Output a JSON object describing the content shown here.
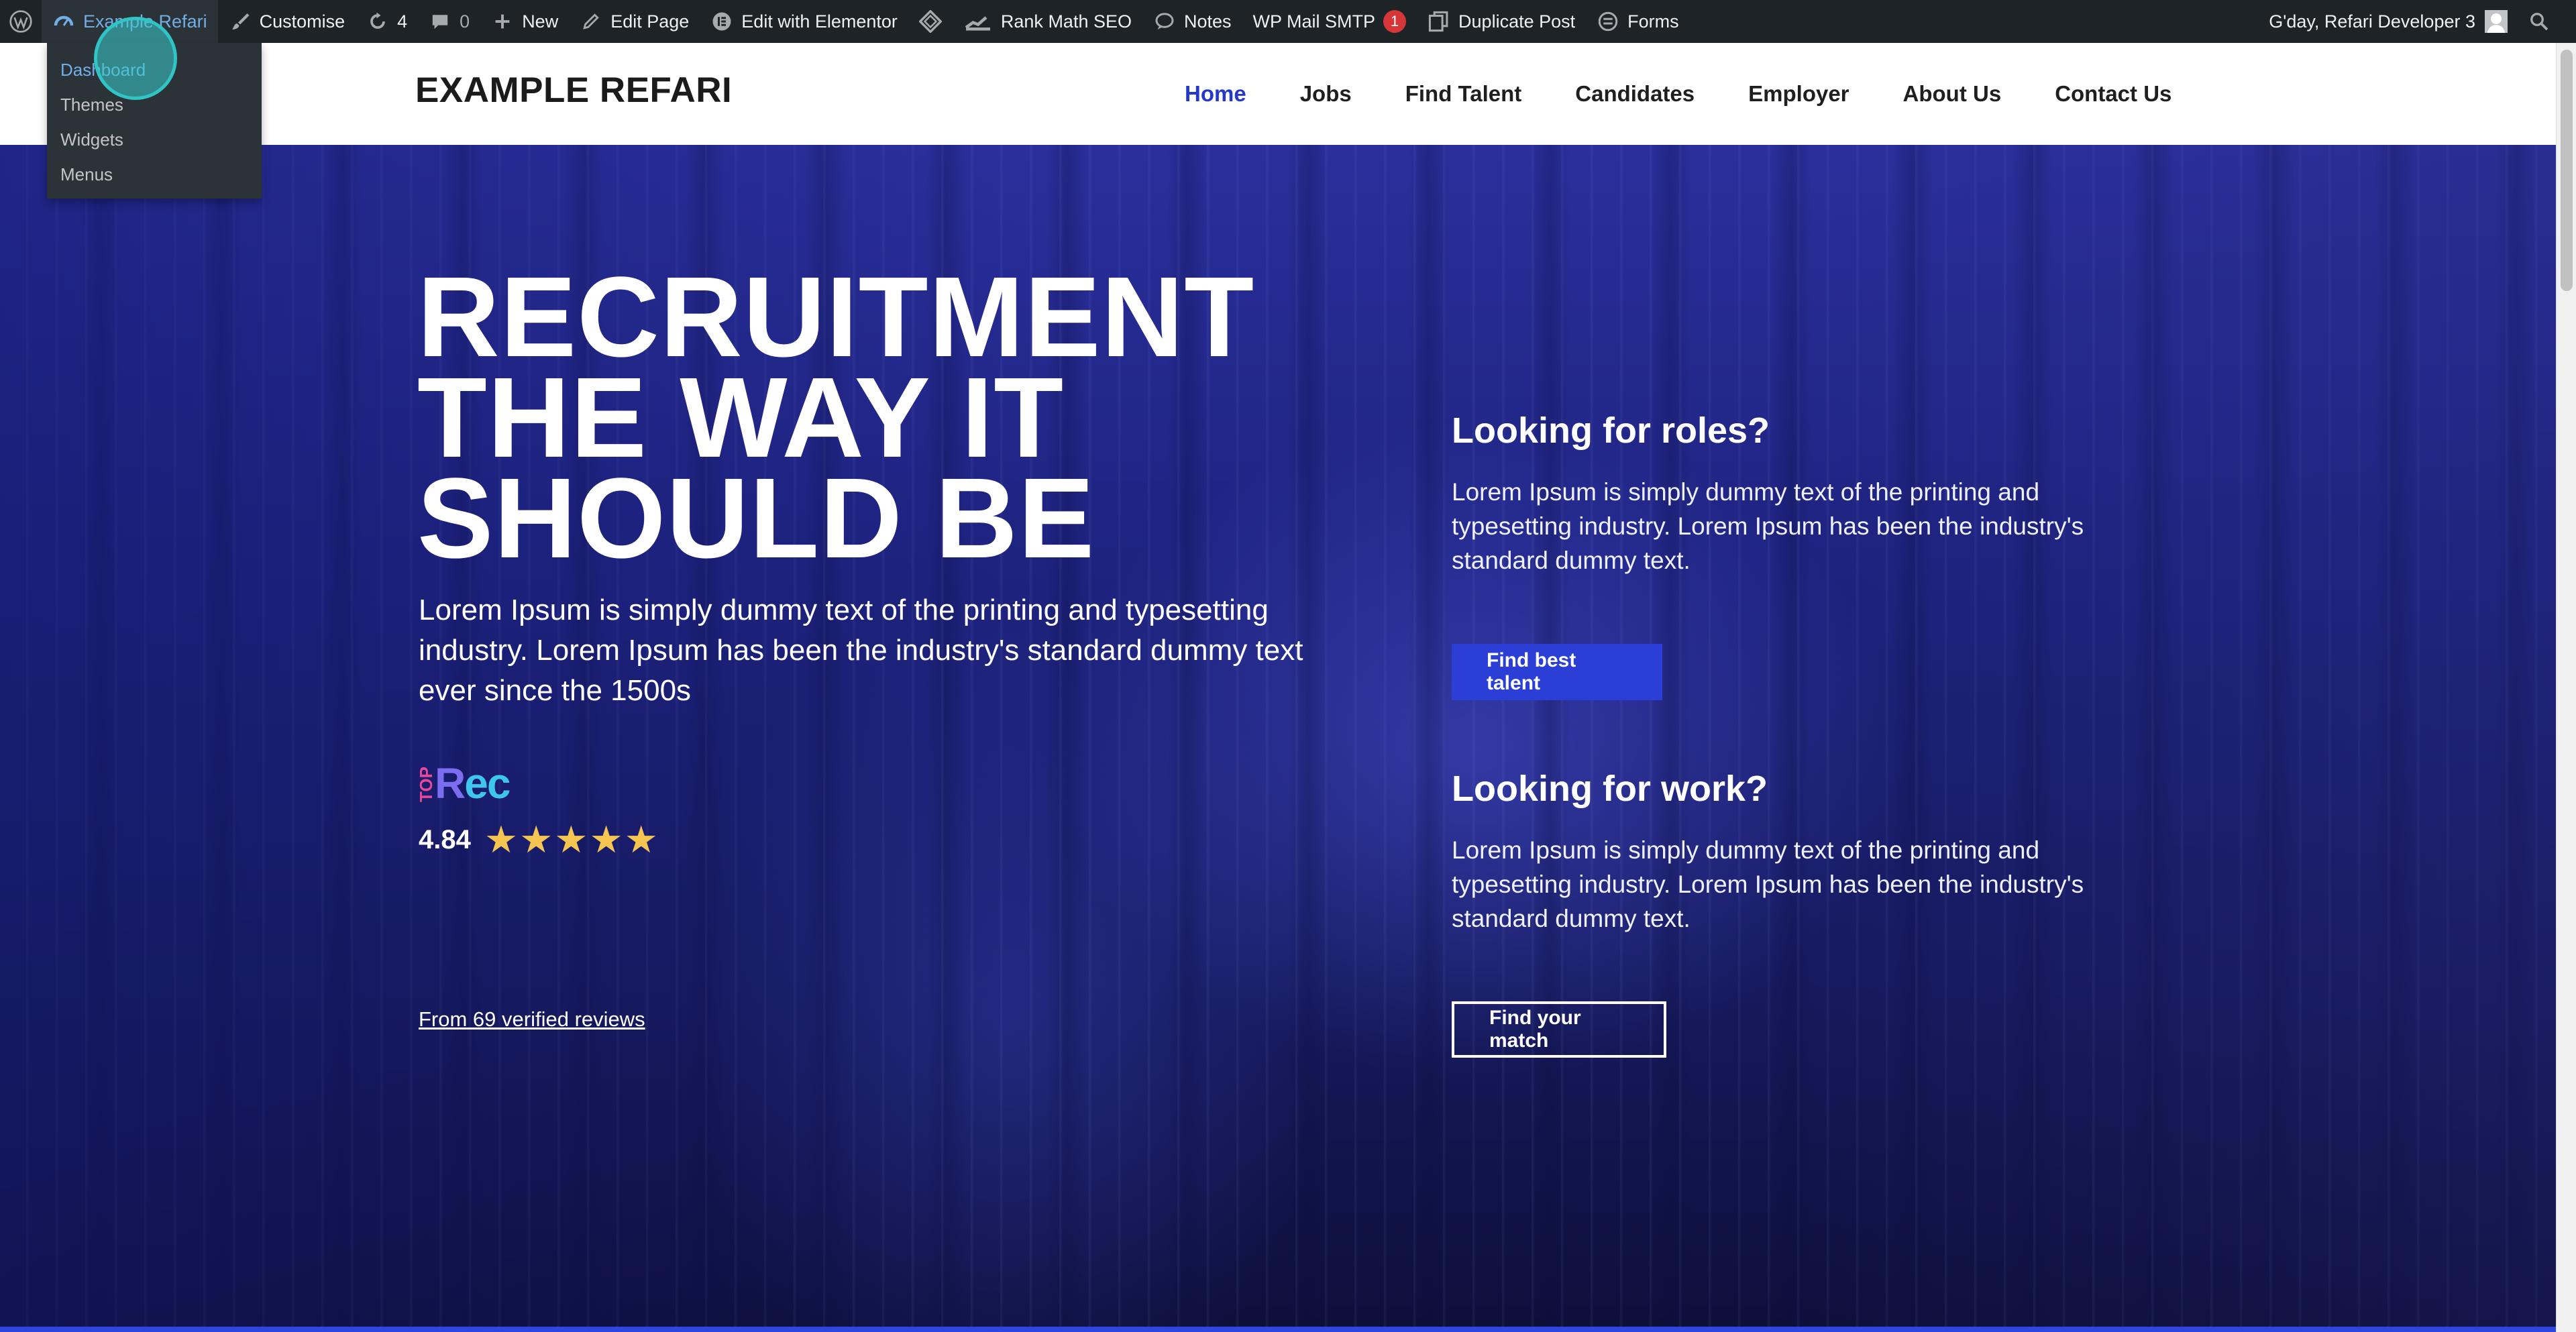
{
  "admin_bar": {
    "site_name": "Example Refari",
    "customise": "Customise",
    "updates_count": "4",
    "comments_count": "0",
    "new": "New",
    "edit_page": "Edit Page",
    "edit_elementor": "Edit with Elementor",
    "rank_math": "Rank Math SEO",
    "notes": "Notes",
    "wp_mail_smtp": "WP Mail SMTP",
    "smtp_badge": "1",
    "duplicate_post": "Duplicate Post",
    "forms": "Forms",
    "greeting": "G'day, Refari Developer 3"
  },
  "site_menu": {
    "items": [
      "Dashboard",
      "Themes",
      "Widgets",
      "Menus"
    ]
  },
  "header": {
    "logo": "EXAMPLE REFARI",
    "nav": [
      "Home",
      "Jobs",
      "Find Talent",
      "Candidates",
      "Employer",
      "About Us",
      "Contact Us"
    ]
  },
  "hero": {
    "headline": [
      "RECRUITMENT",
      "THE WAY IT",
      "SHOULD BE"
    ],
    "subtitle": "Lorem Ipsum is simply dummy text of the printing and typesetting industry. Lorem Ipsum has been the industry's standard dummy text ever since the 1500s",
    "brand_top": "TOP",
    "brand_rec_r": "R",
    "brand_rec_rest": "ec",
    "rating": "4.84",
    "reviews_link": "From 69 verified reviews"
  },
  "roles": {
    "title": "Looking for roles?",
    "body": "Lorem Ipsum is simply dummy text of the printing and typesetting industry. Lorem Ipsum has been the industry's standard dummy text.",
    "button": "Find best talent"
  },
  "work": {
    "title": "Looking for work?",
    "body": "Lorem Ipsum is simply dummy text of the printing and typesetting industry. Lorem Ipsum has been the industry's standard dummy text.",
    "button": "Find your match"
  },
  "colors": {
    "accent": "#2438c9",
    "admin_bar": "#1d2327",
    "star": "#f5c451"
  }
}
